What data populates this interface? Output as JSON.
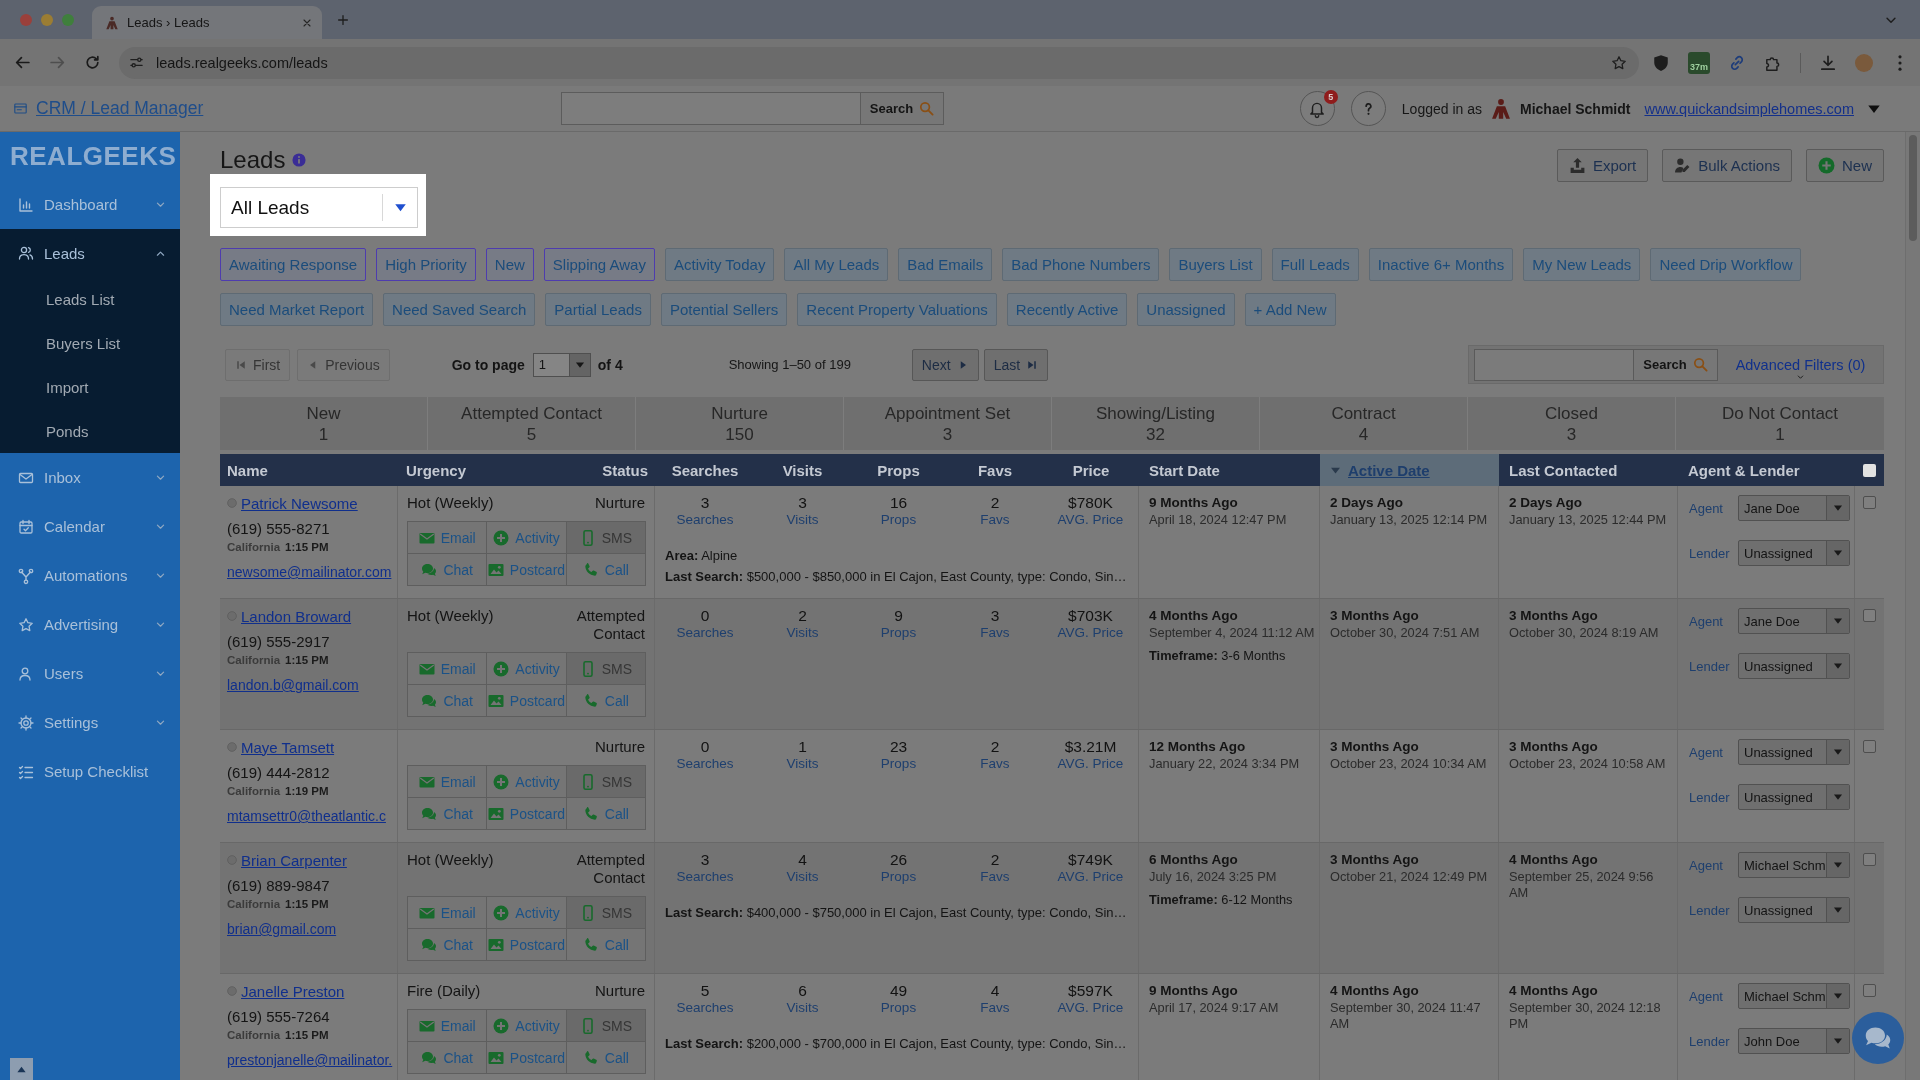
{
  "browser": {
    "tab_title": "Leads › Leads",
    "url": "leads.realgeeks.com/leads",
    "extension_badge": "37m"
  },
  "header": {
    "app_link": "CRM / Lead Manager",
    "search_button": "Search",
    "notification_count": "5",
    "logged_in_label": "Logged in as",
    "user_name": "Michael Schmidt",
    "site_link": "www.quickandsimplehomes.com"
  },
  "sidebar": {
    "logo": "REALGEEKS",
    "items": [
      {
        "label": "Dashboard",
        "expanded": false
      },
      {
        "label": "Leads",
        "expanded": true,
        "children": [
          {
            "label": "Leads List"
          },
          {
            "label": "Buyers List"
          },
          {
            "label": "Import"
          },
          {
            "label": "Ponds"
          }
        ]
      },
      {
        "label": "Inbox",
        "expanded": false
      },
      {
        "label": "Calendar",
        "expanded": false
      },
      {
        "label": "Automations",
        "expanded": false
      },
      {
        "label": "Advertising",
        "expanded": false
      },
      {
        "label": "Users",
        "expanded": false
      },
      {
        "label": "Settings",
        "expanded": false
      },
      {
        "label": "Setup Checklist"
      }
    ]
  },
  "page": {
    "title": "Leads",
    "view_select": "All Leads",
    "buttons": [
      "Export",
      "Bulk Actions",
      "New"
    ]
  },
  "filter_rows": [
    {
      "chips": [
        {
          "label": "Awaiting Response",
          "selected": true
        },
        {
          "label": "High Priority",
          "selected": true
        },
        {
          "label": "New",
          "selected": true
        },
        {
          "label": "Slipping Away",
          "selected": true
        },
        {
          "label": "Activity Today",
          "selected": false
        },
        {
          "label": "All My Leads",
          "selected": false
        },
        {
          "label": "Bad Emails",
          "selected": false
        },
        {
          "label": "Bad Phone Numbers",
          "selected": false
        },
        {
          "label": "Buyers List",
          "selected": false
        },
        {
          "label": "Full Leads",
          "selected": false
        },
        {
          "label": "Inactive 6+ Months",
          "selected": false
        },
        {
          "label": "My New Leads",
          "selected": false
        },
        {
          "label": "Need Drip Workflow",
          "selected": false
        }
      ]
    },
    {
      "chips": [
        {
          "label": "Need Market Report",
          "selected": false
        },
        {
          "label": "Need Saved Search",
          "selected": false
        },
        {
          "label": "Partial Leads",
          "selected": false
        },
        {
          "label": "Potential Sellers",
          "selected": false
        },
        {
          "label": "Recent Property Valuations",
          "selected": false
        },
        {
          "label": "Recently Active",
          "selected": false
        },
        {
          "label": "Unassigned",
          "selected": false
        }
      ],
      "add_button": "+ Add New"
    }
  ],
  "pagination": {
    "back_buttons": [
      {
        "label": "First",
        "disabled": true
      },
      {
        "label": "Previous",
        "disabled": true
      }
    ],
    "go_to_label": "Go to page",
    "page": "1",
    "page_count": "of 4",
    "showing": "Showing 1–50 of 199",
    "forward_buttons": [
      {
        "label": "Next",
        "disabled": false
      },
      {
        "label": "Last",
        "disabled": false
      }
    ],
    "search_button": "Search",
    "advanced_filters": "Advanced Filters (0)"
  },
  "stages": [
    {
      "label": "New",
      "count": "1"
    },
    {
      "label": "Attempted Contact",
      "count": "5"
    },
    {
      "label": "Nurture",
      "count": "150"
    },
    {
      "label": "Appointment Set",
      "count": "3"
    },
    {
      "label": "Showing/Listing",
      "count": "32"
    },
    {
      "label": "Contract",
      "count": "4"
    },
    {
      "label": "Closed",
      "count": "3"
    },
    {
      "label": "Do Not Contact",
      "count": "1"
    }
  ],
  "table": {
    "columns": [
      {
        "label": "Name",
        "sorted": false
      },
      {
        "label": "Urgency",
        "sorted": false
      },
      {
        "label": "Status",
        "sorted": false
      },
      {
        "label": "Searches",
        "sorted": false
      },
      {
        "label": "Visits",
        "sorted": false
      },
      {
        "label": "Props",
        "sorted": false
      },
      {
        "label": "Favs",
        "sorted": false
      },
      {
        "label": "Price",
        "sorted": false
      },
      {
        "label": "Start Date",
        "sorted": false
      },
      {
        "label": "Active Date",
        "sorted": true
      },
      {
        "label": "Last Contacted",
        "sorted": false
      },
      {
        "label": "Agent & Lender",
        "sorted": false
      }
    ],
    "select_all": {
      "checked": false
    },
    "rows": [
      {
        "name": "Patrick Newsome",
        "phone": "(619) 555-8271",
        "region": "California",
        "local_time": "1:15 PM",
        "email": "newsome@mailinator.com",
        "urgency": "Hot (Weekly)",
        "status": "Nurture",
        "actions": [
          {
            "label": "Email",
            "disabled": false
          },
          {
            "label": "Activity",
            "disabled": false
          },
          {
            "label": "SMS",
            "disabled": true
          },
          {
            "label": "Chat",
            "disabled": false
          },
          {
            "label": "Postcard",
            "disabled": false
          },
          {
            "label": "Call",
            "disabled": false
          }
        ],
        "stats": [
          {
            "value": "3",
            "label": "Searches"
          },
          {
            "value": "3",
            "label": "Visits"
          },
          {
            "value": "16",
            "label": "Props"
          },
          {
            "value": "2",
            "label": "Favs"
          },
          {
            "value": "$780K",
            "label": "AVG. Price"
          }
        ],
        "notes": [
          "**Area:** Alpine",
          "**Last Search:** $500,000 - $850,000 in El Cajon, East County, type: Condo, Sin…"
        ],
        "start_date": {
          "ago": "9 Months Ago",
          "date": "April 18, 2024 12:47 PM"
        },
        "active_date": {
          "ago": "2 Days Ago",
          "date": "January 13, 2025 12:14 PM"
        },
        "last_contacted": {
          "ago": "2 Days Ago",
          "date": "January 13, 2025 12:44 PM"
        },
        "assignments": [
          {
            "role": "Agent",
            "value": "Jane Doe"
          },
          {
            "role": "Lender",
            "value": "Unassigned"
          }
        ],
        "checked": false
      },
      {
        "name": "Landon Broward",
        "phone": "(619) 555-2917",
        "region": "California",
        "local_time": "1:15 PM",
        "email": "landon.b@gmail.com",
        "urgency": "Hot (Weekly)",
        "status": "Attempted Contact",
        "actions": [
          {
            "label": "Email",
            "disabled": false
          },
          {
            "label": "Activity",
            "disabled": false
          },
          {
            "label": "SMS",
            "disabled": true
          },
          {
            "label": "Chat",
            "disabled": false
          },
          {
            "label": "Postcard",
            "disabled": false
          },
          {
            "label": "Call",
            "disabled": false
          }
        ],
        "stats": [
          {
            "value": "0",
            "label": "Searches"
          },
          {
            "value": "2",
            "label": "Visits"
          },
          {
            "value": "9",
            "label": "Props"
          },
          {
            "value": "3",
            "label": "Favs"
          },
          {
            "value": "$703K",
            "label": "AVG. Price"
          }
        ],
        "start_date": {
          "ago": "4 Months Ago",
          "date": "September 4, 2024 11:12 AM",
          "note": "**Timeframe:** 3-6 Months"
        },
        "active_date": {
          "ago": "3 Months Ago",
          "date": "October 30, 2024 7:51 AM"
        },
        "last_contacted": {
          "ago": "3 Months Ago",
          "date": "October 30, 2024 8:19 AM"
        },
        "assignments": [
          {
            "role": "Agent",
            "value": "Jane Doe"
          },
          {
            "role": "Lender",
            "value": "Unassigned"
          }
        ],
        "checked": false
      },
      {
        "name": "Maye Tamsett",
        "phone": "(619) 444-2812",
        "region": "California",
        "local_time": "1:19 PM",
        "email": "mtamsettr0@theatlantic.c",
        "status": "Nurture",
        "actions": [
          {
            "label": "Email",
            "disabled": false
          },
          {
            "label": "Activity",
            "disabled": false
          },
          {
            "label": "SMS",
            "disabled": true
          },
          {
            "label": "Chat",
            "disabled": false
          },
          {
            "label": "Postcard",
            "disabled": false
          },
          {
            "label": "Call",
            "disabled": false
          }
        ],
        "stats": [
          {
            "value": "0",
            "label": "Searches"
          },
          {
            "value": "1",
            "label": "Visits"
          },
          {
            "value": "23",
            "label": "Props"
          },
          {
            "value": "2",
            "label": "Favs"
          },
          {
            "value": "$3.21M",
            "label": "AVG. Price"
          }
        ],
        "start_date": {
          "ago": "12 Months Ago",
          "date": "January 22, 2024 3:34 PM"
        },
        "active_date": {
          "ago": "3 Months Ago",
          "date": "October 23, 2024 10:34 AM"
        },
        "last_contacted": {
          "ago": "3 Months Ago",
          "date": "October 23, 2024 10:58 AM"
        },
        "assignments": [
          {
            "role": "Agent",
            "value": "Unassigned"
          },
          {
            "role": "Lender",
            "value": "Unassigned"
          }
        ],
        "checked": false
      },
      {
        "name": "Brian Carpenter",
        "phone": "(619) 889-9847",
        "region": "California",
        "local_time": "1:15 PM",
        "email": "brian@gmail.com",
        "urgency": "Hot (Weekly)",
        "status": "Attempted Contact",
        "actions": [
          {
            "label": "Email",
            "disabled": false
          },
          {
            "label": "Activity",
            "disabled": false
          },
          {
            "label": "SMS",
            "disabled": true
          },
          {
            "label": "Chat",
            "disabled": false
          },
          {
            "label": "Postcard",
            "disabled": false
          },
          {
            "label": "Call",
            "disabled": false
          }
        ],
        "stats": [
          {
            "value": "3",
            "label": "Searches"
          },
          {
            "value": "4",
            "label": "Visits"
          },
          {
            "value": "26",
            "label": "Props"
          },
          {
            "value": "2",
            "label": "Favs"
          },
          {
            "value": "$749K",
            "label": "AVG. Price"
          }
        ],
        "notes": [
          "**Last Search:** $400,000 - $750,000 in El Cajon, East County, type: Condo, Sin…"
        ],
        "start_date": {
          "ago": "6 Months Ago",
          "date": "July 16, 2024 3:25 PM",
          "note": "**Timeframe:** 6-12 Months"
        },
        "active_date": {
          "ago": "3 Months Ago",
          "date": "October 21, 2024 12:49 PM"
        },
        "last_contacted": {
          "ago": "4 Months Ago",
          "date": "September 25, 2024 9:56 AM"
        },
        "assignments": [
          {
            "role": "Agent",
            "value": "Michael Schm"
          },
          {
            "role": "Lender",
            "value": "Unassigned"
          }
        ],
        "checked": false
      },
      {
        "name": "Janelle Preston",
        "phone": "(619) 555-7264",
        "region": "California",
        "local_time": "1:15 PM",
        "email": "prestonjanelle@mailinator.",
        "urgency": "Fire (Daily)",
        "status": "Nurture",
        "actions": [
          {
            "label": "Email",
            "disabled": false
          },
          {
            "label": "Activity",
            "disabled": false
          },
          {
            "label": "SMS",
            "disabled": true
          },
          {
            "label": "Chat",
            "disabled": false
          },
          {
            "label": "Postcard",
            "disabled": false
          },
          {
            "label": "Call",
            "disabled": false
          }
        ],
        "stats": [
          {
            "value": "5",
            "label": "Searches"
          },
          {
            "value": "6",
            "label": "Visits"
          },
          {
            "value": "49",
            "label": "Props"
          },
          {
            "value": "4",
            "label": "Favs"
          },
          {
            "value": "$597K",
            "label": "AVG. Price"
          }
        ],
        "notes": [
          "**Last Search:** $200,000 - $700,000 in El Cajon, East County, type: Condo, Sin…"
        ],
        "start_date": {
          "ago": "9 Months Ago",
          "date": "April 17, 2024 9:17 AM"
        },
        "active_date": {
          "ago": "4 Months Ago",
          "date": "September 30, 2024 11:47 AM"
        },
        "last_contacted": {
          "ago": "4 Months Ago",
          "date": "September 30, 2024 12:18 PM"
        },
        "assignments": [
          {
            "role": "Agent",
            "value": "Michael Schm"
          },
          {
            "role": "Lender",
            "value": "John Doe"
          }
        ],
        "checked": false
      }
    ]
  }
}
